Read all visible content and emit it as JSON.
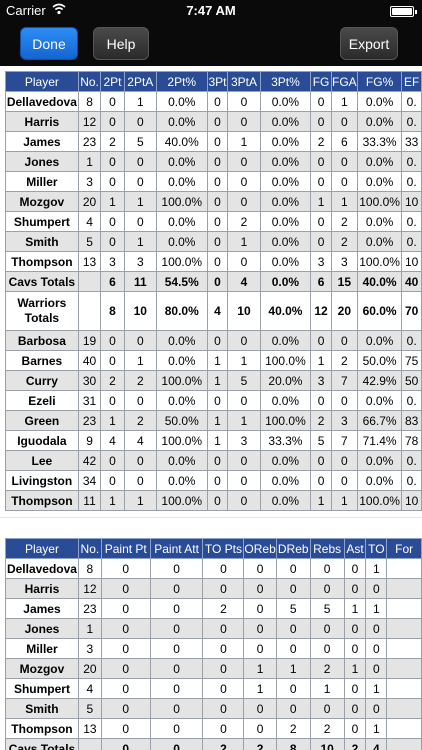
{
  "status_bar": {
    "carrier": "Carrier",
    "time": "7:47 AM"
  },
  "toolbar": {
    "done_label": "Done",
    "help_label": "Help",
    "export_label": "Export"
  },
  "shooting_table": {
    "headers": [
      "Player",
      "No.",
      "2Pt",
      "2PtA",
      "2Pt%",
      "3Pt",
      "3PtA",
      "3Pt%",
      "FG",
      "FGA",
      "FG%",
      "EF"
    ],
    "rows": [
      [
        "Dellavedova",
        "8",
        "0",
        "1",
        "0.0%",
        "0",
        "0",
        "0.0%",
        "0",
        "1",
        "0.0%",
        "0."
      ],
      [
        "Harris",
        "12",
        "0",
        "0",
        "0.0%",
        "0",
        "0",
        "0.0%",
        "0",
        "0",
        "0.0%",
        "0."
      ],
      [
        "James",
        "23",
        "2",
        "5",
        "40.0%",
        "0",
        "1",
        "0.0%",
        "2",
        "6",
        "33.3%",
        "33"
      ],
      [
        "Jones",
        "1",
        "0",
        "0",
        "0.0%",
        "0",
        "0",
        "0.0%",
        "0",
        "0",
        "0.0%",
        "0."
      ],
      [
        "Miller",
        "3",
        "0",
        "0",
        "0.0%",
        "0",
        "0",
        "0.0%",
        "0",
        "0",
        "0.0%",
        "0."
      ],
      [
        "Mozgov",
        "20",
        "1",
        "1",
        "100.0%",
        "0",
        "0",
        "0.0%",
        "1",
        "1",
        "100.0%",
        "10"
      ],
      [
        "Shumpert",
        "4",
        "0",
        "0",
        "0.0%",
        "0",
        "2",
        "0.0%",
        "0",
        "2",
        "0.0%",
        "0."
      ],
      [
        "Smith",
        "5",
        "0",
        "1",
        "0.0%",
        "0",
        "1",
        "0.0%",
        "0",
        "2",
        "0.0%",
        "0."
      ],
      [
        "Thompson",
        "13",
        "3",
        "3",
        "100.0%",
        "0",
        "0",
        "0.0%",
        "3",
        "3",
        "100.0%",
        "10"
      ],
      [
        "Cavs Totals",
        "",
        "6",
        "11",
        "54.5%",
        "0",
        "4",
        "0.0%",
        "6",
        "15",
        "40.0%",
        "40"
      ],
      [
        "Warriors Totals",
        "",
        "8",
        "10",
        "80.0%",
        "4",
        "10",
        "40.0%",
        "12",
        "20",
        "60.0%",
        "70"
      ],
      [
        "Barbosa",
        "19",
        "0",
        "0",
        "0.0%",
        "0",
        "0",
        "0.0%",
        "0",
        "0",
        "0.0%",
        "0."
      ],
      [
        "Barnes",
        "40",
        "0",
        "1",
        "0.0%",
        "1",
        "1",
        "100.0%",
        "1",
        "2",
        "50.0%",
        "75"
      ],
      [
        "Curry",
        "30",
        "2",
        "2",
        "100.0%",
        "1",
        "5",
        "20.0%",
        "3",
        "7",
        "42.9%",
        "50"
      ],
      [
        "Ezeli",
        "31",
        "0",
        "0",
        "0.0%",
        "0",
        "0",
        "0.0%",
        "0",
        "0",
        "0.0%",
        "0."
      ],
      [
        "Green",
        "23",
        "1",
        "2",
        "50.0%",
        "1",
        "1",
        "100.0%",
        "2",
        "3",
        "66.7%",
        "83"
      ],
      [
        "Iguodala",
        "9",
        "4",
        "4",
        "100.0%",
        "1",
        "3",
        "33.3%",
        "5",
        "7",
        "71.4%",
        "78"
      ],
      [
        "Lee",
        "42",
        "0",
        "0",
        "0.0%",
        "0",
        "0",
        "0.0%",
        "0",
        "0",
        "0.0%",
        "0."
      ],
      [
        "Livingston",
        "34",
        "0",
        "0",
        "0.0%",
        "0",
        "0",
        "0.0%",
        "0",
        "0",
        "0.0%",
        "0."
      ],
      [
        "Thompson",
        "11",
        "1",
        "1",
        "100.0%",
        "0",
        "0",
        "0.0%",
        "1",
        "1",
        "100.0%",
        "10"
      ]
    ]
  },
  "misc_table": {
    "headers": [
      "Player",
      "No.",
      "Paint Pt",
      "Paint Att",
      "TO Pts",
      "OReb",
      "DReb",
      "Rebs",
      "Ast",
      "TO",
      "For"
    ],
    "rows": [
      [
        "Dellavedova",
        "8",
        "0",
        "0",
        "0",
        "0",
        "0",
        "0",
        "0",
        "1",
        ""
      ],
      [
        "Harris",
        "12",
        "0",
        "0",
        "0",
        "0",
        "0",
        "0",
        "0",
        "0",
        ""
      ],
      [
        "James",
        "23",
        "0",
        "0",
        "2",
        "0",
        "5",
        "5",
        "1",
        "1",
        ""
      ],
      [
        "Jones",
        "1",
        "0",
        "0",
        "0",
        "0",
        "0",
        "0",
        "0",
        "0",
        ""
      ],
      [
        "Miller",
        "3",
        "0",
        "0",
        "0",
        "0",
        "0",
        "0",
        "0",
        "0",
        ""
      ],
      [
        "Mozgov",
        "20",
        "0",
        "0",
        "0",
        "1",
        "1",
        "2",
        "1",
        "0",
        ""
      ],
      [
        "Shumpert",
        "4",
        "0",
        "0",
        "0",
        "1",
        "0",
        "1",
        "0",
        "1",
        ""
      ],
      [
        "Smith",
        "5",
        "0",
        "0",
        "0",
        "0",
        "0",
        "0",
        "0",
        "0",
        ""
      ],
      [
        "Thompson",
        "13",
        "0",
        "0",
        "0",
        "0",
        "2",
        "2",
        "0",
        "1",
        ""
      ],
      [
        "Cavs Totals",
        "",
        "0",
        "0",
        "2",
        "2",
        "8",
        "10",
        "2",
        "4",
        ""
      ]
    ]
  }
}
